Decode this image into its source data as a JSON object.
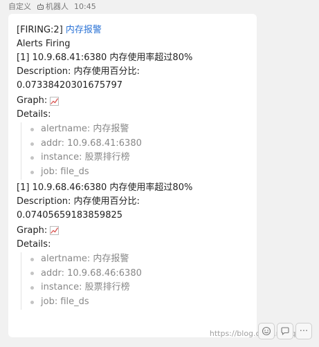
{
  "header": {
    "custom": "自定义",
    "robot_label": "机器人",
    "time": "10:45"
  },
  "message": {
    "status": "[FIRING:2]",
    "alert_name": "内存报警",
    "alerts_firing": "Alerts Firing",
    "alerts": [
      {
        "summary": "[1] 10.9.68.41:6380 内存使用率超过80%",
        "description_label": "Description: 内存使用百分比:",
        "value": "0.07338420301675797",
        "graph_label": "Graph:",
        "details_label": "Details:",
        "details": [
          "alertname: 内存报警",
          "addr: 10.9.68.41:6380",
          "instance: 股票排行榜",
          "job: file_ds"
        ]
      },
      {
        "summary": "[1] 10.9.68.46:6380 内存使用率超过80%",
        "description_label": "Description: 内存使用百分比:",
        "value": "0.07405659183859825",
        "graph_label": "Graph:",
        "details_label": "Details:",
        "details": [
          "alertname: 内存报警",
          "addr: 10.9.68.46:6380",
          "instance: 股票排行榜",
          "job: file_ds"
        ]
      }
    ]
  },
  "watermark": "https://blog.csdn.net/qq_3",
  "toolbar": {
    "emoji_icon": "smile-icon",
    "reply_icon": "chat-icon",
    "more_label": "···"
  },
  "colors": {
    "link": "#2b73d6",
    "bubble": "#ffffff",
    "background": "#f1f1f1"
  }
}
